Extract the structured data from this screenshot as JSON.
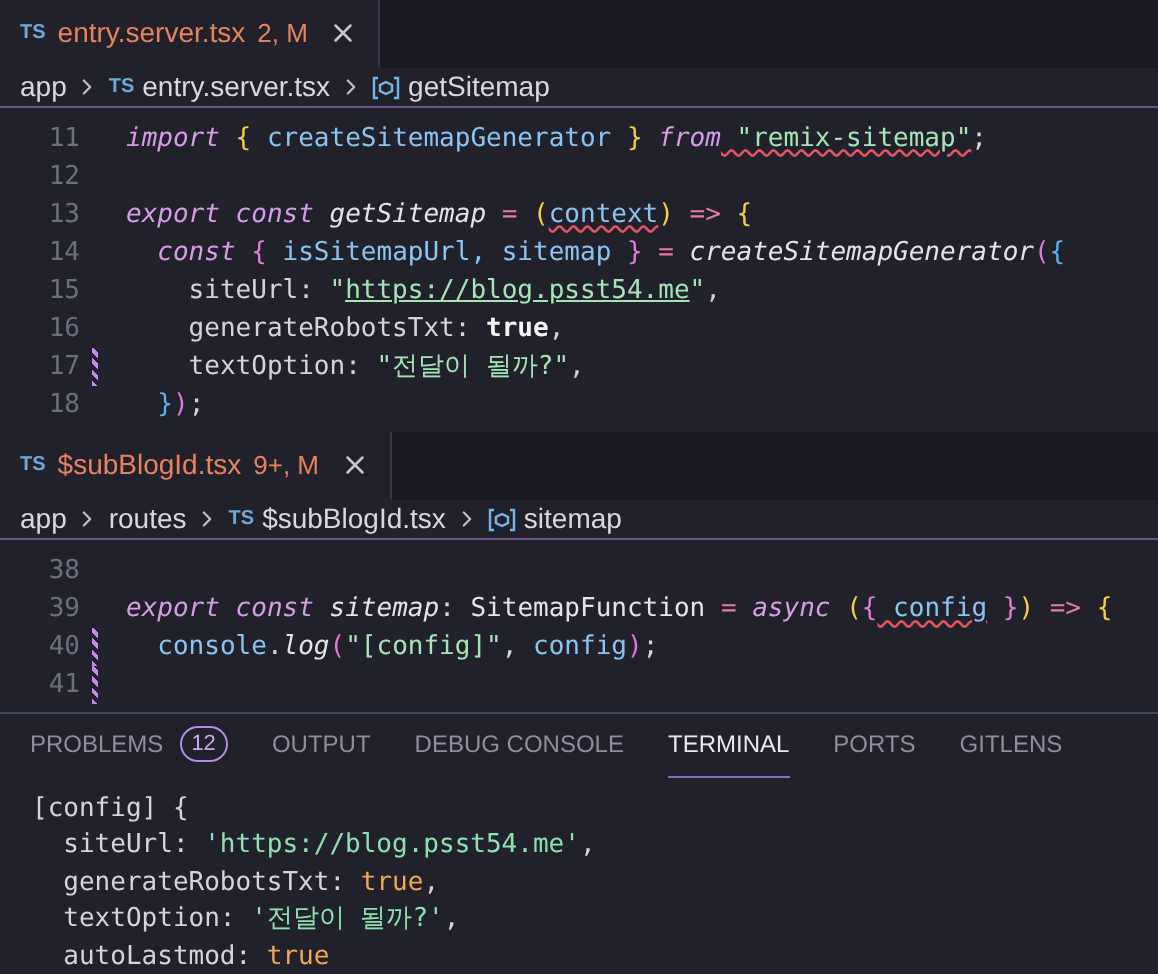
{
  "editors": [
    {
      "tab": {
        "icon_text": "TS",
        "label": "entry.server.tsx",
        "status": "2, M",
        "selected": true
      },
      "breadcrumb": [
        {
          "kind": "folder",
          "text": "app"
        },
        {
          "kind": "file",
          "icon_text": "TS",
          "text": "entry.server.tsx"
        },
        {
          "kind": "symbol",
          "text": "getSitemap"
        }
      ],
      "lines": [
        {
          "number": "11",
          "modified": false,
          "tokens": [
            {
              "kind": "kw",
              "text": "import"
            },
            {
              "kind": "brace1",
              "text": " {"
            },
            {
              "kind": "fn",
              "text": " createSitemapGenerator"
            },
            {
              "kind": "brace1",
              "text": " }"
            },
            {
              "kind": "kw",
              "text": " from"
            },
            {
              "kind": "str",
              "text": " \"remix-sitemap\"",
              "squiggle": true
            },
            {
              "kind": "plain",
              "text": ";"
            }
          ]
        },
        {
          "number": "12",
          "modified": false
        },
        {
          "number": "13",
          "modified": false,
          "tokens": [
            {
              "kind": "kw",
              "text": "export"
            },
            {
              "kind": "kw",
              "text": " const"
            },
            {
              "kind": "var",
              "text": " getSitemap"
            },
            {
              "kind": "op",
              "text": " ="
            },
            {
              "kind": "brace1",
              "text": " ("
            },
            {
              "kind": "param",
              "text": "context",
              "squiggle": true
            },
            {
              "kind": "brace1",
              "text": ")"
            },
            {
              "kind": "op",
              "text": " =>"
            },
            {
              "kind": "brace1",
              "text": " {"
            }
          ]
        },
        {
          "number": "14",
          "modified": false,
          "tokens": [
            {
              "kind": "kw",
              "text": "  const"
            },
            {
              "kind": "brace2",
              "text": " {"
            },
            {
              "kind": "fn",
              "text": " isSitemapUrl, sitemap"
            },
            {
              "kind": "brace2",
              "text": " }"
            },
            {
              "kind": "op",
              "text": " ="
            },
            {
              "kind": "call",
              "text": " createSitemapGenerator"
            },
            {
              "kind": "brace2",
              "text": "("
            },
            {
              "kind": "brace3",
              "text": "{"
            }
          ]
        },
        {
          "number": "15",
          "modified": false,
          "tokens": [
            {
              "kind": "prop",
              "text": "    siteUrl: "
            },
            {
              "kind": "str",
              "text": "\""
            },
            {
              "kind": "link",
              "text": "https://blog.psst54.me"
            },
            {
              "kind": "str",
              "text": "\""
            },
            {
              "kind": "plain",
              "text": ","
            }
          ]
        },
        {
          "number": "16",
          "modified": false,
          "tokens": [
            {
              "kind": "prop",
              "text": "    generateRobotsTxt: "
            },
            {
              "kind": "bool",
              "text": "true"
            },
            {
              "kind": "plain",
              "text": ","
            }
          ]
        },
        {
          "number": "17",
          "modified": true,
          "tokens": [
            {
              "kind": "prop",
              "text": "    textOption: "
            },
            {
              "kind": "str",
              "text": "\"전달이 될까?\""
            },
            {
              "kind": "plain",
              "text": ","
            }
          ]
        },
        {
          "number": "18",
          "modified": false,
          "tokens": [
            {
              "kind": "brace3",
              "text": "  }"
            },
            {
              "kind": "brace2",
              "text": ")"
            },
            {
              "kind": "plain",
              "text": ";"
            }
          ]
        }
      ]
    },
    {
      "tab": {
        "icon_text": "TS",
        "label": "$subBlogId.tsx",
        "status": "9+, M",
        "selected": true
      },
      "breadcrumb": [
        {
          "kind": "folder",
          "text": "app"
        },
        {
          "kind": "folder",
          "text": "routes"
        },
        {
          "kind": "file",
          "icon_text": "TS",
          "text": "$subBlogId.tsx"
        },
        {
          "kind": "symbol",
          "text": "sitemap"
        }
      ],
      "lines": [
        {
          "number": "38",
          "modified": false
        },
        {
          "number": "39",
          "modified": false,
          "tokens": [
            {
              "kind": "kw",
              "text": "export"
            },
            {
              "kind": "kw",
              "text": " const"
            },
            {
              "kind": "var",
              "text": " sitemap"
            },
            {
              "kind": "plain",
              "text": ":"
            },
            {
              "kind": "type",
              "text": " SitemapFunction"
            },
            {
              "kind": "op",
              "text": " ="
            },
            {
              "kind": "kw",
              "text": " async"
            },
            {
              "kind": "brace1",
              "text": " ("
            },
            {
              "kind": "brace2",
              "text": "{"
            },
            {
              "kind": "param",
              "text": " config",
              "squiggle": true
            },
            {
              "kind": "brace2",
              "text": " }"
            },
            {
              "kind": "brace1",
              "text": ")"
            },
            {
              "kind": "op",
              "text": " =>"
            },
            {
              "kind": "brace1",
              "text": " {"
            }
          ]
        },
        {
          "number": "40",
          "modified": true,
          "tokens": [
            {
              "kind": "fn",
              "text": "  console"
            },
            {
              "kind": "plain",
              "text": "."
            },
            {
              "kind": "call",
              "text": "log"
            },
            {
              "kind": "brace2",
              "text": "("
            },
            {
              "kind": "str",
              "text": "\"[config]\""
            },
            {
              "kind": "plain",
              "text": ","
            },
            {
              "kind": "fn",
              "text": " config"
            },
            {
              "kind": "brace2",
              "text": ")"
            },
            {
              "kind": "plain",
              "text": ";"
            }
          ]
        },
        {
          "number": "41",
          "modified": true
        }
      ]
    }
  ],
  "panel": {
    "tabs": [
      {
        "label": "PROBLEMS",
        "badge": "12",
        "selected": false
      },
      {
        "label": "OUTPUT",
        "selected": false
      },
      {
        "label": "DEBUG CONSOLE",
        "selected": false
      },
      {
        "label": "TERMINAL",
        "selected": true
      },
      {
        "label": "PORTS",
        "selected": false
      },
      {
        "label": "GITLENS",
        "selected": false
      }
    ],
    "terminal_lines": [
      [
        {
          "kind": "plain",
          "text": "[config] {"
        }
      ],
      [
        {
          "kind": "plain",
          "text": "  siteUrl: "
        },
        {
          "kind": "tstr",
          "text": "'https://blog.psst54.me'"
        },
        {
          "kind": "plain",
          "text": ","
        }
      ],
      [
        {
          "kind": "plain",
          "text": "  generateRobotsTxt: "
        },
        {
          "kind": "tbool",
          "text": "true"
        },
        {
          "kind": "plain",
          "text": ","
        }
      ],
      [
        {
          "kind": "plain",
          "text": "  textOption: "
        },
        {
          "kind": "tstr",
          "text": "'전달이 될까?'"
        },
        {
          "kind": "plain",
          "text": ","
        }
      ],
      [
        {
          "kind": "plain",
          "text": "  autoLastmod: "
        },
        {
          "kind": "tbool",
          "text": "true"
        }
      ]
    ]
  }
}
